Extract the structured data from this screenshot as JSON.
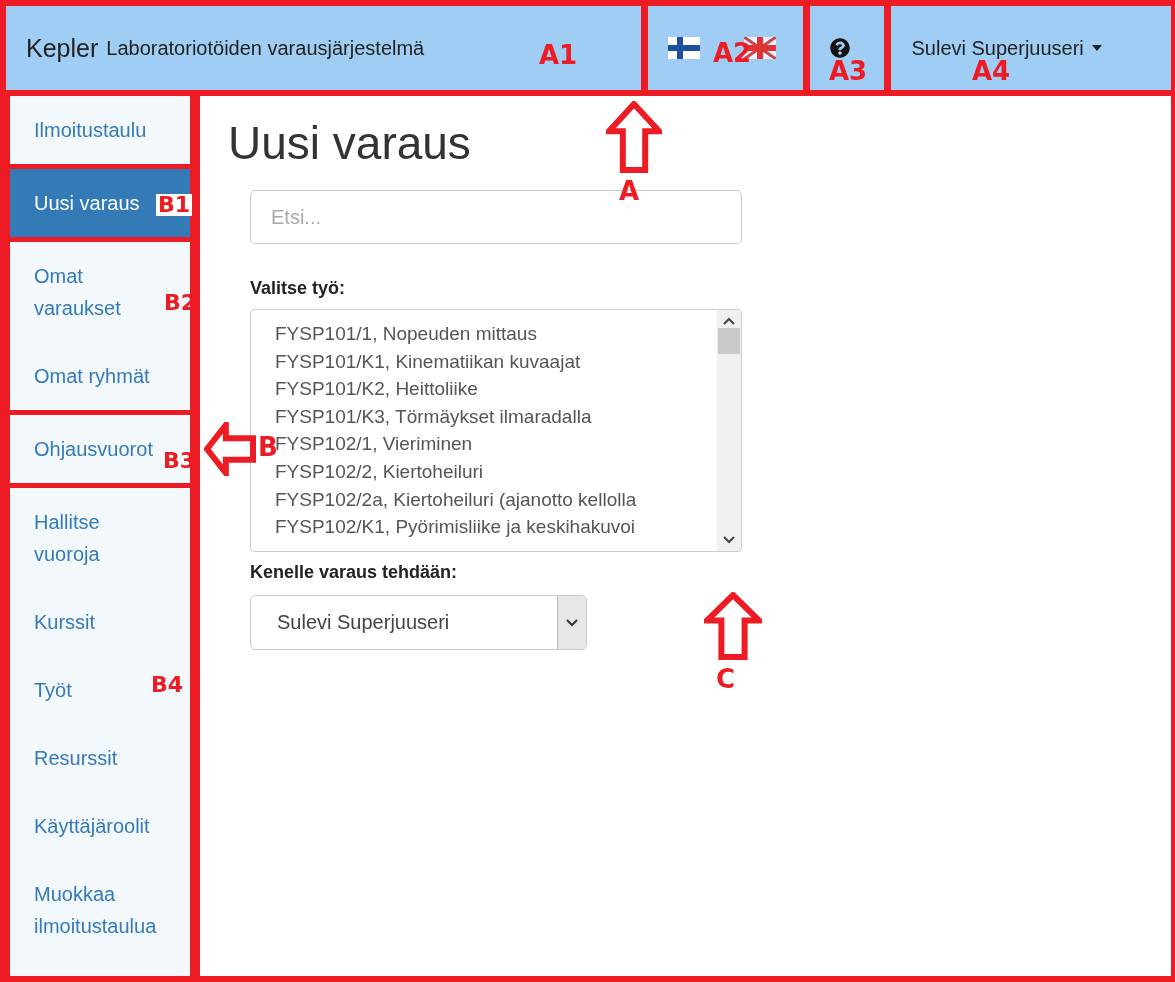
{
  "header": {
    "brand": "Kepler",
    "subtitle": "Laboratoriotöiden varausjärjestelmä",
    "user": "Sulevi Superjuuseri"
  },
  "sidebar": {
    "groups": [
      {
        "items": [
          {
            "label": "Ilmoitustaulu",
            "selected": false
          }
        ]
      },
      {
        "items": [
          {
            "label": "Uusi varaus",
            "selected": true
          }
        ]
      },
      {
        "items": [
          {
            "label": "Omat varaukset",
            "selected": false
          },
          {
            "label": "Omat ryhmät",
            "selected": false
          }
        ]
      },
      {
        "items": [
          {
            "label": "Ohjausvuorot",
            "selected": false
          }
        ]
      },
      {
        "items": [
          {
            "label": "Hallitse vuoroja",
            "selected": false
          },
          {
            "label": "Kurssit",
            "selected": false
          },
          {
            "label": "Työt",
            "selected": false
          },
          {
            "label": "Resurssit",
            "selected": false
          },
          {
            "label": "Käyttäjäroolit",
            "selected": false
          },
          {
            "label": "Muokkaa ilmoitustaulua",
            "selected": false
          }
        ]
      }
    ]
  },
  "main": {
    "title": "Uusi varaus",
    "search": {
      "placeholder": "Etsi..."
    },
    "work_label": "Valitse työ:",
    "works": [
      "FYSP101/1, Nopeuden mittaus",
      "FYSP101/K1, Kinematiikan kuvaajat",
      "FYSP101/K2, Heittoliike",
      "FYSP101/K3, Törmäykset ilmaradalla",
      "FYSP102/1, Vieriminen",
      "FYSP102/2, Kiertoheiluri",
      "FYSP102/2a, Kiertoheiluri (ajanotto kellolla",
      "FYSP102/K1, Pyörimisliike ja keskihakuvoi"
    ],
    "for_label": "Kenelle varaus tehdään:",
    "for_value": "Sulevi Superjuuseri"
  },
  "annotations": {
    "header_labels": [
      "A1",
      "A2",
      "A3",
      "A4"
    ],
    "sidebar_labels": [
      "B1",
      "B2",
      "B3",
      "B4"
    ],
    "arrows": [
      {
        "label": "A"
      },
      {
        "label": "B"
      },
      {
        "label": "C"
      }
    ]
  }
}
